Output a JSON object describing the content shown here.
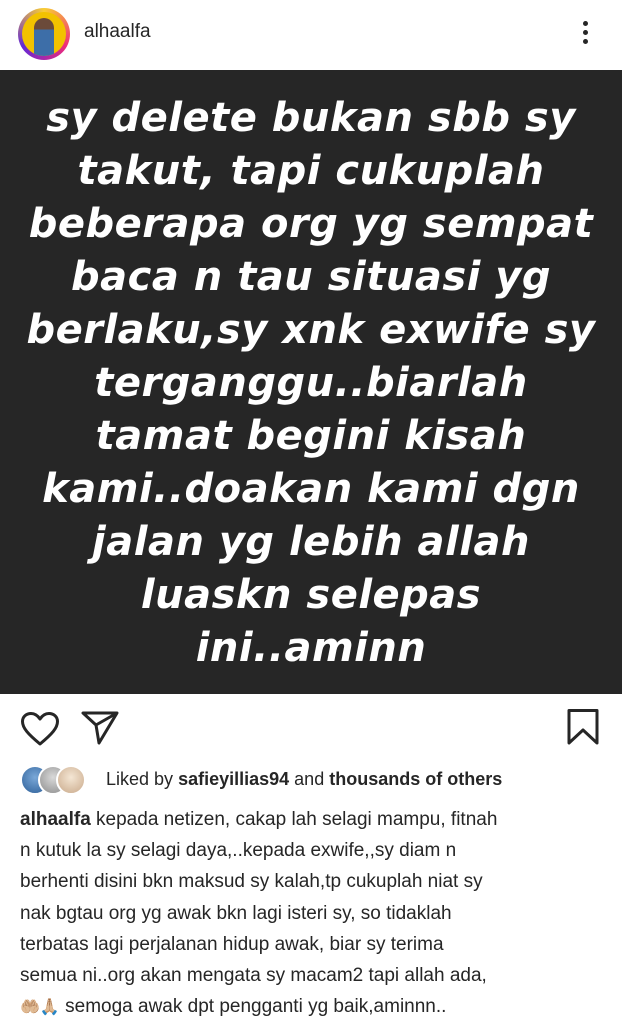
{
  "header": {
    "username": "alhaalfa"
  },
  "post": {
    "image_text_lines": [
      "sy delete bukan sbb sy",
      "takut, tapi cukuplah",
      "beberapa org yg sempat",
      "baca n tau situasi yg",
      "berlaku,sy xnk exwife sy",
      "terganggu..biarlah",
      "tamat begini kisah",
      "kami..doakan kami dgn",
      "jalan yg lebih allah",
      "luaskn selepas",
      "ini..aminn"
    ],
    "background_color": "#262626",
    "text_color": "#ffffff"
  },
  "likes": {
    "prefix": "Liked by",
    "user": "safieyillias94",
    "joiner": "and",
    "others": "thousands of others"
  },
  "caption": {
    "username": "alhaalfa",
    "first_line": "kepada netizen, cakap lah selagi mampu, fitnah",
    "lines": [
      "n kutuk la sy selagi daya,..kepada exwife,,sy diam n",
      "berhenti disini bkn maksud sy kalah,tp cukuplah niat sy",
      "nak bgtau org yg awak bkn lagi isteri sy, so tidaklah",
      "terbatas lagi perjalanan hidup awak, biar sy terima",
      "semua ni..org akan mengata sy macam2 tapi allah ada,"
    ],
    "last_line_emojis": "🤲🏼🙏🏼",
    "last_line": " semoga awak dpt pengganti yg baik,aminnn.."
  },
  "icons": [
    "heart-icon",
    "share-icon",
    "bookmark-icon",
    "more-options-icon"
  ]
}
